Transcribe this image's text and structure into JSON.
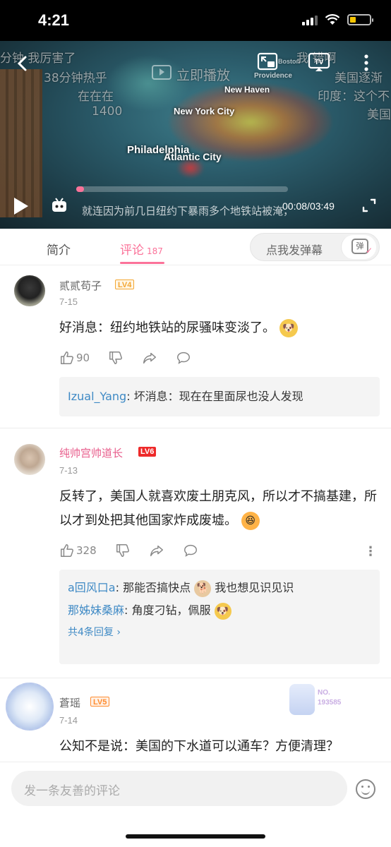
{
  "status_bar": {
    "time": "4:21"
  },
  "video": {
    "map_labels": [
      "New Haven",
      "New York City",
      "Philadelphia",
      "Atlantic City",
      "Providence",
      "Boston"
    ],
    "danmaku": [
      {
        "text": "分钟 我厉害了"
      },
      {
        "text": "38分钟热乎"
      },
      {
        "text": "在在在"
      },
      {
        "text": "1400"
      },
      {
        "text": "立即播放"
      },
      {
        "text": "我      错啊"
      },
      {
        "text": "美国逐渐"
      },
      {
        "text": "印度：这个不"
      },
      {
        "text": "美国"
      }
    ],
    "subtitle": "就连因为前几日纽约下暴雨多个地铁站被淹，",
    "current_time": "00:08",
    "total_time": "03:49",
    "progress": 0.035
  },
  "tabs": {
    "intro_label": "简介",
    "comments_label": "评论",
    "comments_count": "187",
    "danmaku_placeholder": "点我发弹幕",
    "danmaku_button": "弹"
  },
  "comments": [
    {
      "username": "贰贰苟子",
      "level": "LV4",
      "date": "7-15",
      "text": "好消息：纽约地铁站的尿骚味变淡了。",
      "likes": "90",
      "replies": [
        {
          "name": "Izual_Yang",
          "text": ": 坏消息：现在在里面尿也没人发现"
        }
      ]
    },
    {
      "username": "纯帅宫帅道长",
      "level": "LV6",
      "date": "7-13",
      "text": "反转了，美国人就喜欢废土朋克风，所以才不搞基建，所以才到处把其他国家炸成废墟。",
      "likes": "328",
      "replies": [
        {
          "name": "a回风口a",
          "text": ": 那能否搞快点",
          "after": " 我也想见识见识"
        },
        {
          "name": "那姊妹桑麻",
          "text": ": 角度刁钻，佩服"
        }
      ],
      "all_replies": "共4条回复 ›"
    },
    {
      "username": "蒼瑶",
      "level": "LV5",
      "date": "7-14",
      "text": "公知不是说：美国的下水道可以通车？方便清理？",
      "medal_line1": "NO.",
      "medal_line2": "193585"
    }
  ],
  "bottom": {
    "placeholder": "发一条友善的评论"
  }
}
